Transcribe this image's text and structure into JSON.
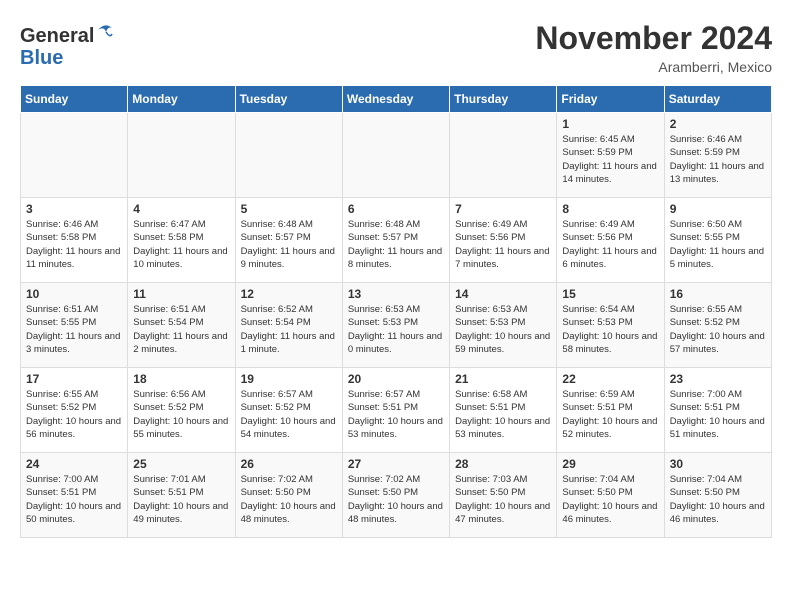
{
  "header": {
    "logo_line1": "General",
    "logo_line2": "Blue",
    "month_title": "November 2024",
    "location": "Aramberri, Mexico"
  },
  "days_of_week": [
    "Sunday",
    "Monday",
    "Tuesday",
    "Wednesday",
    "Thursday",
    "Friday",
    "Saturday"
  ],
  "weeks": [
    [
      {
        "day": "",
        "info": ""
      },
      {
        "day": "",
        "info": ""
      },
      {
        "day": "",
        "info": ""
      },
      {
        "day": "",
        "info": ""
      },
      {
        "day": "",
        "info": ""
      },
      {
        "day": "1",
        "info": "Sunrise: 6:45 AM\nSunset: 5:59 PM\nDaylight: 11 hours and 14 minutes."
      },
      {
        "day": "2",
        "info": "Sunrise: 6:46 AM\nSunset: 5:59 PM\nDaylight: 11 hours and 13 minutes."
      }
    ],
    [
      {
        "day": "3",
        "info": "Sunrise: 6:46 AM\nSunset: 5:58 PM\nDaylight: 11 hours and 11 minutes."
      },
      {
        "day": "4",
        "info": "Sunrise: 6:47 AM\nSunset: 5:58 PM\nDaylight: 11 hours and 10 minutes."
      },
      {
        "day": "5",
        "info": "Sunrise: 6:48 AM\nSunset: 5:57 PM\nDaylight: 11 hours and 9 minutes."
      },
      {
        "day": "6",
        "info": "Sunrise: 6:48 AM\nSunset: 5:57 PM\nDaylight: 11 hours and 8 minutes."
      },
      {
        "day": "7",
        "info": "Sunrise: 6:49 AM\nSunset: 5:56 PM\nDaylight: 11 hours and 7 minutes."
      },
      {
        "day": "8",
        "info": "Sunrise: 6:49 AM\nSunset: 5:56 PM\nDaylight: 11 hours and 6 minutes."
      },
      {
        "day": "9",
        "info": "Sunrise: 6:50 AM\nSunset: 5:55 PM\nDaylight: 11 hours and 5 minutes."
      }
    ],
    [
      {
        "day": "10",
        "info": "Sunrise: 6:51 AM\nSunset: 5:55 PM\nDaylight: 11 hours and 3 minutes."
      },
      {
        "day": "11",
        "info": "Sunrise: 6:51 AM\nSunset: 5:54 PM\nDaylight: 11 hours and 2 minutes."
      },
      {
        "day": "12",
        "info": "Sunrise: 6:52 AM\nSunset: 5:54 PM\nDaylight: 11 hours and 1 minute."
      },
      {
        "day": "13",
        "info": "Sunrise: 6:53 AM\nSunset: 5:53 PM\nDaylight: 11 hours and 0 minutes."
      },
      {
        "day": "14",
        "info": "Sunrise: 6:53 AM\nSunset: 5:53 PM\nDaylight: 10 hours and 59 minutes."
      },
      {
        "day": "15",
        "info": "Sunrise: 6:54 AM\nSunset: 5:53 PM\nDaylight: 10 hours and 58 minutes."
      },
      {
        "day": "16",
        "info": "Sunrise: 6:55 AM\nSunset: 5:52 PM\nDaylight: 10 hours and 57 minutes."
      }
    ],
    [
      {
        "day": "17",
        "info": "Sunrise: 6:55 AM\nSunset: 5:52 PM\nDaylight: 10 hours and 56 minutes."
      },
      {
        "day": "18",
        "info": "Sunrise: 6:56 AM\nSunset: 5:52 PM\nDaylight: 10 hours and 55 minutes."
      },
      {
        "day": "19",
        "info": "Sunrise: 6:57 AM\nSunset: 5:52 PM\nDaylight: 10 hours and 54 minutes."
      },
      {
        "day": "20",
        "info": "Sunrise: 6:57 AM\nSunset: 5:51 PM\nDaylight: 10 hours and 53 minutes."
      },
      {
        "day": "21",
        "info": "Sunrise: 6:58 AM\nSunset: 5:51 PM\nDaylight: 10 hours and 53 minutes."
      },
      {
        "day": "22",
        "info": "Sunrise: 6:59 AM\nSunset: 5:51 PM\nDaylight: 10 hours and 52 minutes."
      },
      {
        "day": "23",
        "info": "Sunrise: 7:00 AM\nSunset: 5:51 PM\nDaylight: 10 hours and 51 minutes."
      }
    ],
    [
      {
        "day": "24",
        "info": "Sunrise: 7:00 AM\nSunset: 5:51 PM\nDaylight: 10 hours and 50 minutes."
      },
      {
        "day": "25",
        "info": "Sunrise: 7:01 AM\nSunset: 5:51 PM\nDaylight: 10 hours and 49 minutes."
      },
      {
        "day": "26",
        "info": "Sunrise: 7:02 AM\nSunset: 5:50 PM\nDaylight: 10 hours and 48 minutes."
      },
      {
        "day": "27",
        "info": "Sunrise: 7:02 AM\nSunset: 5:50 PM\nDaylight: 10 hours and 48 minutes."
      },
      {
        "day": "28",
        "info": "Sunrise: 7:03 AM\nSunset: 5:50 PM\nDaylight: 10 hours and 47 minutes."
      },
      {
        "day": "29",
        "info": "Sunrise: 7:04 AM\nSunset: 5:50 PM\nDaylight: 10 hours and 46 minutes."
      },
      {
        "day": "30",
        "info": "Sunrise: 7:04 AM\nSunset: 5:50 PM\nDaylight: 10 hours and 46 minutes."
      }
    ]
  ]
}
